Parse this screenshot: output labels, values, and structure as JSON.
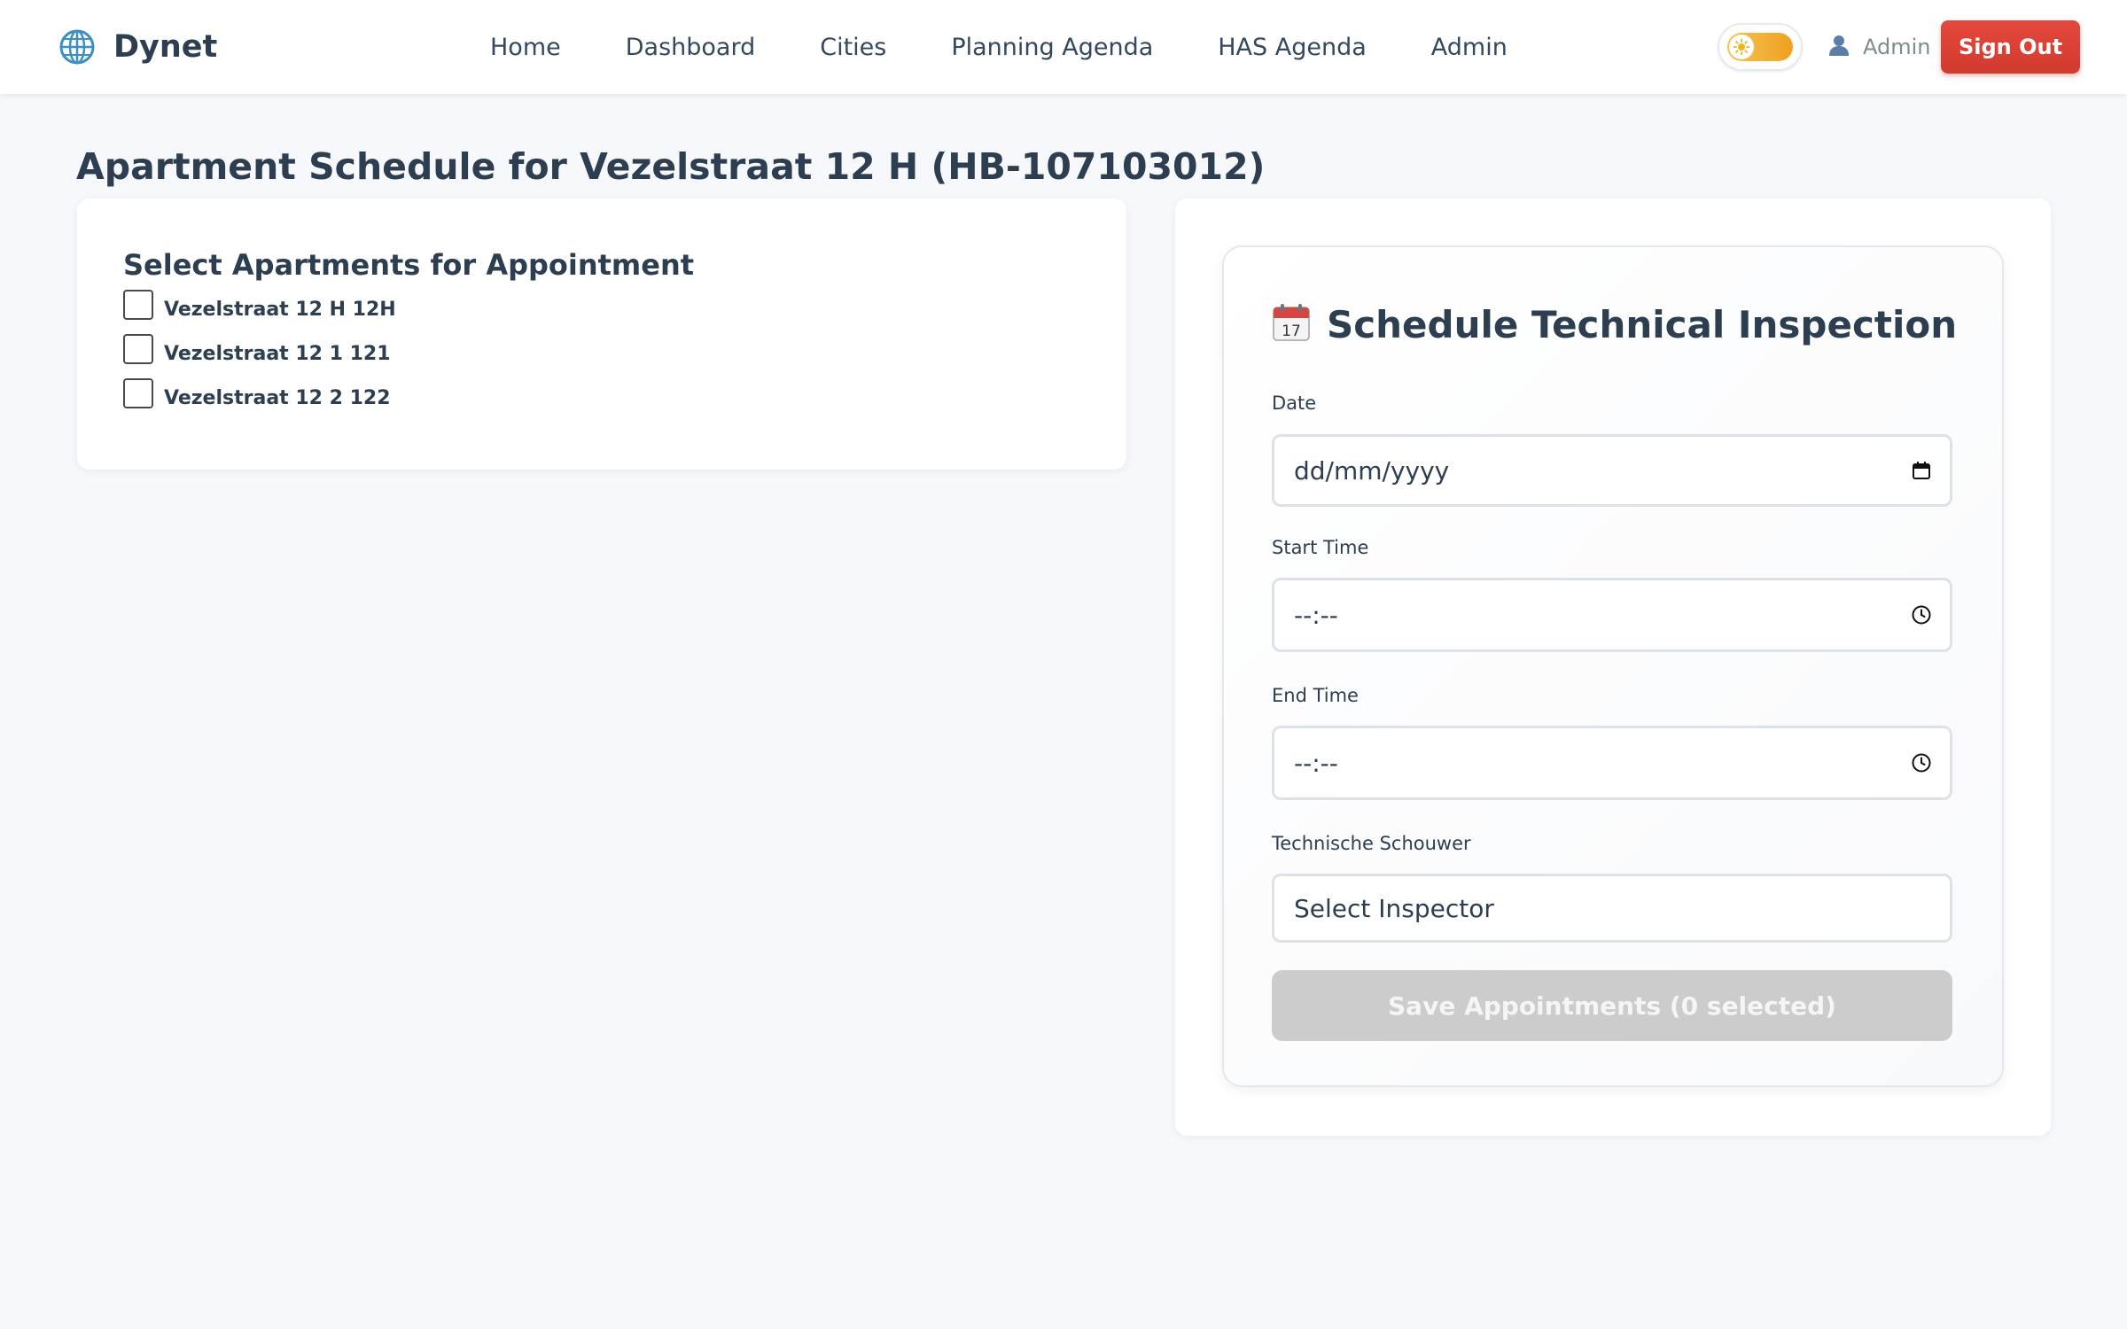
{
  "nav": {
    "brand": "Dynet",
    "links": [
      "Home",
      "Dashboard",
      "Cities",
      "Planning Agenda",
      "HAS Agenda",
      "Admin"
    ],
    "user_label": "Admin",
    "signout_label": "Sign Out",
    "theme": "light"
  },
  "page": {
    "title": "Apartment Schedule for Vezelstraat 12 H (HB-107103012)"
  },
  "apartments": {
    "heading": "Select Apartments for Appointment",
    "items": [
      {
        "label": "Vezelstraat 12 H 12H",
        "checked": false
      },
      {
        "label": "Vezelstraat 12 1 121",
        "checked": false
      },
      {
        "label": "Vezelstraat 12 2 122",
        "checked": false
      }
    ]
  },
  "form": {
    "title": "Schedule Technical Inspection",
    "title_icon": "calendar-icon",
    "date_label": "Date",
    "date_placeholder": "dd/mm/yyyy",
    "start_label": "Start Time",
    "start_placeholder": "--:--",
    "end_label": "End Time",
    "end_placeholder": "--:--",
    "inspector_label": "Technische Schouwer",
    "inspector_value": "Select Inspector",
    "save_label": "Save Appointments (0 selected)"
  },
  "colors": {
    "signout": "#e5483c",
    "toggle": "#f0a020",
    "disabled_button": "#cccccc",
    "text": "#2c3e50"
  }
}
